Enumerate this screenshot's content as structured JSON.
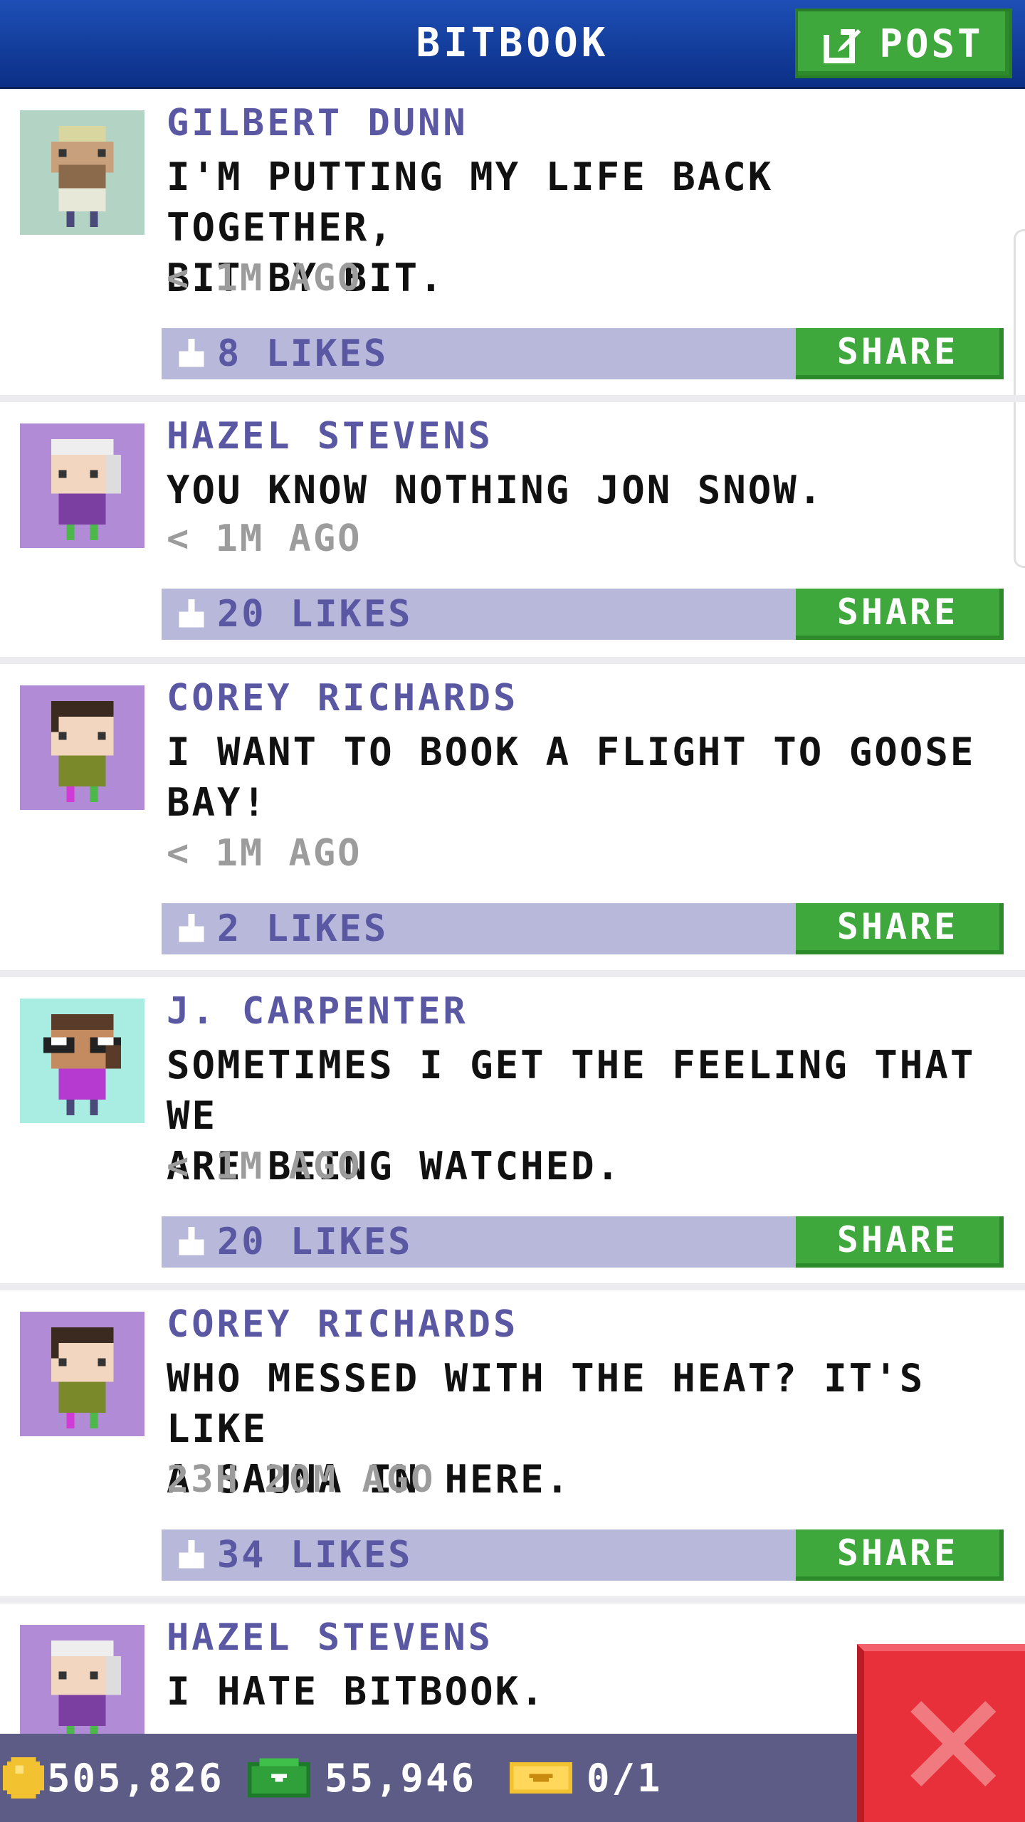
{
  "header": {
    "title": "BITBOOK",
    "post_label": "POST"
  },
  "colors": {
    "header_blue": "#1b48ad",
    "accent_green": "#3fa83c",
    "author_purple": "#5a57a3",
    "like_bar": "#b7b8da",
    "close_red": "#e8303a"
  },
  "posts": [
    {
      "author": "GILBERT DUNN",
      "text_lines": [
        "I'M PUTTING MY LIFE BACK TOGETHER,",
        "BIT BY BIT."
      ],
      "time": "< 1M AGO",
      "likes": "8 LIKES",
      "share_label": "SHARE",
      "avatar_icon": "bearded-old-man-avatar-icon"
    },
    {
      "author": "HAZEL STEVENS",
      "text_lines": [
        "YOU KNOW NOTHING JON SNOW."
      ],
      "time": "< 1M AGO",
      "likes": "20 LIKES",
      "share_label": "SHARE",
      "avatar_icon": "grey-haired-woman-avatar-icon"
    },
    {
      "author": "COREY RICHARDS",
      "text_lines": [
        "I WANT TO BOOK A FLIGHT TO GOOSE",
        "BAY!"
      ],
      "time": "< 1M AGO",
      "likes": "2 LIKES",
      "share_label": "SHARE",
      "avatar_icon": "dark-haired-man-avatar-icon"
    },
    {
      "author": "J. CARPENTER",
      "text_lines": [
        "SOMETIMES I GET THE FEELING THAT WE",
        "ARE BEING WATCHED."
      ],
      "time": "< 1M AGO",
      "likes": "20 LIKES",
      "share_label": "SHARE",
      "avatar_icon": "glasses-woman-avatar-icon"
    },
    {
      "author": "COREY RICHARDS",
      "text_lines": [
        "WHO MESSED WITH THE HEAT? IT'S LIKE",
        "A SAUNA IN HERE."
      ],
      "time": "23H 20M AGO",
      "likes": "34 LIKES",
      "share_label": "SHARE",
      "avatar_icon": "dark-haired-man-avatar-icon"
    },
    {
      "author": "HAZEL STEVENS",
      "text_lines": [
        "I HATE BITBOOK."
      ],
      "time": "",
      "likes": "",
      "share_label": "",
      "avatar_icon": "grey-haired-woman-avatar-icon"
    }
  ],
  "bottom_bar": {
    "coins": "505,826",
    "bux": "55,946",
    "tickets": "0/1"
  }
}
